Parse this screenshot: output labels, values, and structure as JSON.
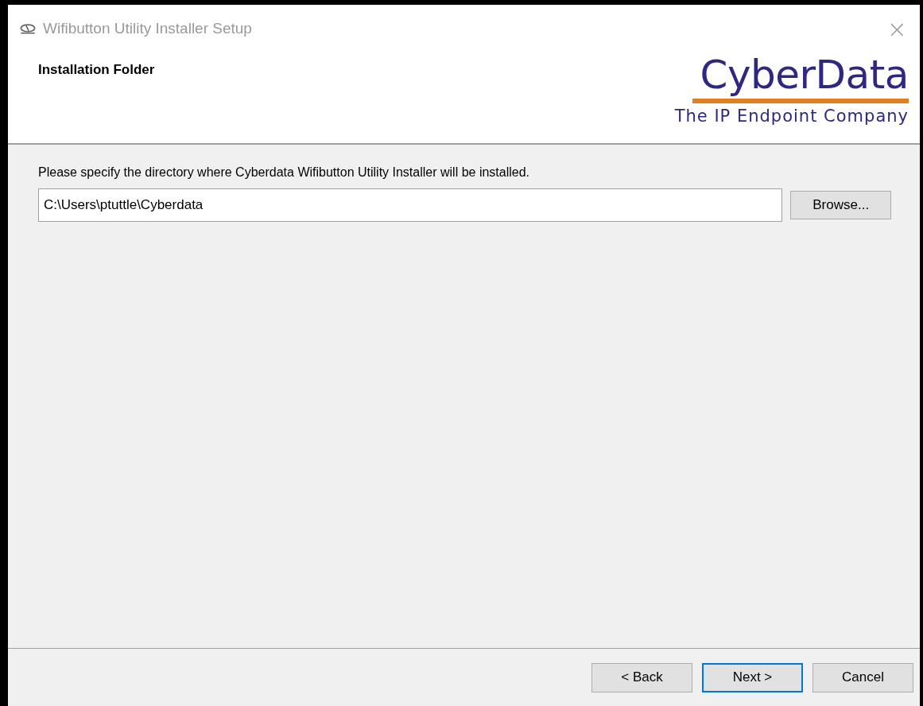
{
  "window": {
    "title": "Wifibutton Utility Installer Setup",
    "close": "×"
  },
  "header": {
    "title": "Installation Folder",
    "logo": {
      "name": "CyberData",
      "tagline": "The IP Endpoint Company"
    }
  },
  "content": {
    "prompt": "Please specify the directory where Cyberdata Wifibutton Utility Installer will be installed.",
    "path_field": {
      "value": "C:\\Users\\ptuttle\\Cyberdata"
    },
    "browse_button": "Browse..."
  },
  "buttons": [
    {
      "label": "< Back",
      "focused": false
    },
    {
      "label": "Next >",
      "focused": true
    },
    {
      "label": "Cancel",
      "focused": false
    }
  ]
}
